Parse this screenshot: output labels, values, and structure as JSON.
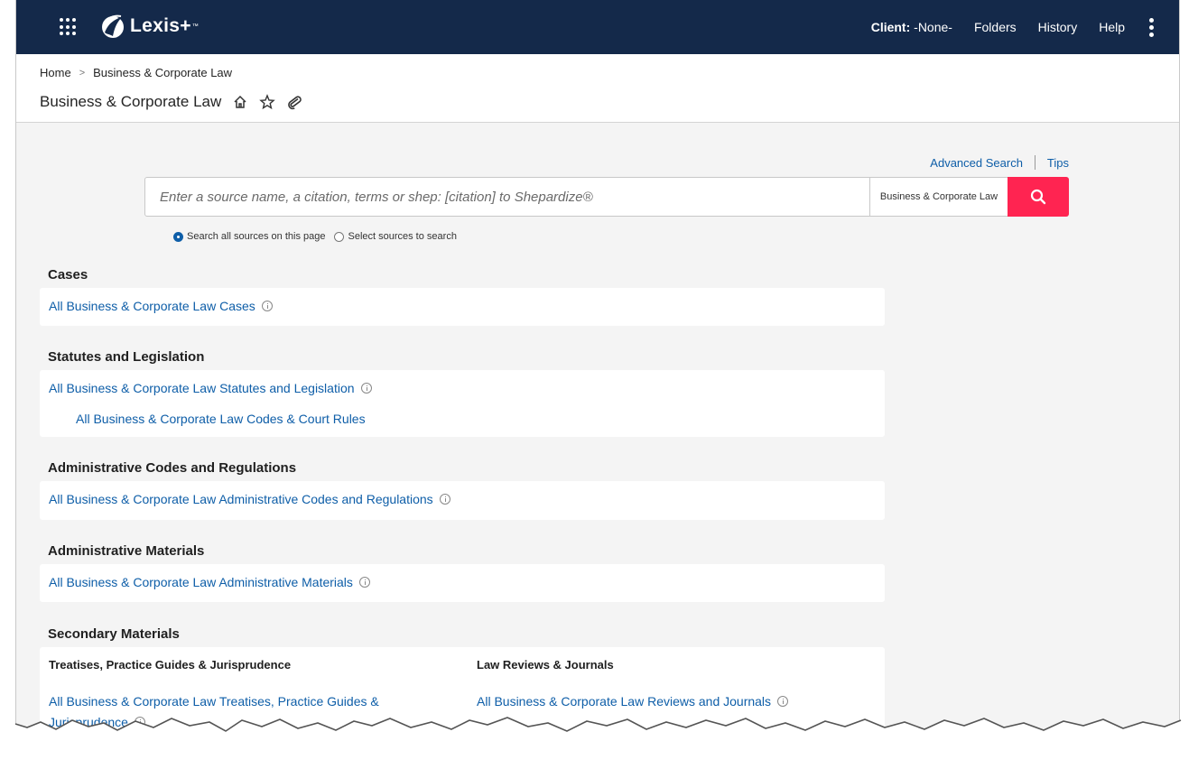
{
  "topbar": {
    "brand": "Lexis+",
    "brand_tm": "™",
    "client_label": "Client:",
    "client_value": "-None-",
    "folders": "Folders",
    "history": "History",
    "help": "Help"
  },
  "breadcrumb": {
    "home": "Home",
    "current": "Business & Corporate Law"
  },
  "page_title": "Business & Corporate Law",
  "search": {
    "advanced": "Advanced Search",
    "tips": "Tips",
    "placeholder": "Enter a source name, a citation, terms or shep: [citation] to Shepardize®",
    "scope": "Business & Corporate Law",
    "radio_all": "Search all sources on this page",
    "radio_select": "Select sources to search"
  },
  "sections": {
    "cases": {
      "title": "Cases",
      "link": "All Business & Corporate Law Cases"
    },
    "statutes": {
      "title": "Statutes and Legislation",
      "link": "All Business & Corporate Law Statutes and Legislation",
      "sublink": "All Business & Corporate Law Codes & Court Rules"
    },
    "admin_codes": {
      "title": "Administrative Codes and Regulations",
      "link": "All Business & Corporate Law Administrative Codes and Regulations"
    },
    "admin_materials": {
      "title": "Administrative Materials",
      "link": "All Business & Corporate Law Administrative Materials"
    },
    "secondary": {
      "title": "Secondary Materials",
      "col1_head": "Treatises, Practice Guides & Jurisprudence",
      "col1_link": "All Business & Corporate Law Treatises, Practice Guides &",
      "col1_link_cont": "Jurisprudence",
      "col2_head": "Law Reviews & Journals",
      "col2_link": "All Business & Corporate Law Reviews and Journals"
    }
  },
  "colors": {
    "topbar": "#14294a",
    "link": "#0e5ea8",
    "search_button": "#ff2451",
    "page_bg": "#f4f4f4"
  }
}
